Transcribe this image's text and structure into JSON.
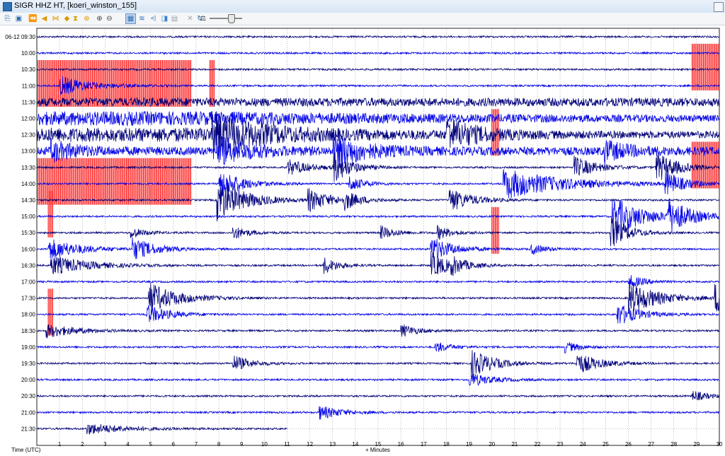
{
  "window": {
    "title": "SIGR HHZ HT, [koeri_winston_155]"
  },
  "toolbar": {
    "tools": [
      {
        "name": "copy-tool",
        "glyph": "⎘",
        "color": "#2a6fb0"
      },
      {
        "name": "export-tool",
        "glyph": "▣",
        "color": "#2a6fb0"
      },
      {
        "name": "jump-back-icon",
        "glyph": "⏪",
        "color": "#d89a00"
      },
      {
        "name": "step-back-icon",
        "glyph": "◀",
        "color": "#d89a00"
      },
      {
        "name": "compress-time-icon",
        "glyph": "⋈",
        "color": "#d89a00"
      },
      {
        "name": "expand-time-icon",
        "glyph": "◆",
        "color": "#d89a00"
      },
      {
        "name": "hourglass-icon",
        "glyph": "⧗",
        "color": "#d89a00"
      },
      {
        "name": "history-icon",
        "glyph": "⊛",
        "color": "#d89a00"
      },
      {
        "name": "zoom-in-icon",
        "glyph": "⊕",
        "color": "#444444"
      },
      {
        "name": "zoom-out-icon",
        "glyph": "⊖",
        "color": "#444444"
      },
      {
        "name": "grid-view-icon",
        "glyph": "▦",
        "color": "#2a6fb0"
      },
      {
        "name": "wave-view-icon",
        "glyph": "≋",
        "color": "#2a6fb0"
      },
      {
        "name": "spectra-icon",
        "glyph": "⩤",
        "color": "#2a6fb0"
      },
      {
        "name": "spectrogram-icon",
        "glyph": "◨",
        "color": "#3a7fd0"
      },
      {
        "name": "clipboard-icon",
        "glyph": "▤",
        "color": "#9aa4ae"
      },
      {
        "name": "close-icon",
        "glyph": "✕",
        "color": "#9aa4ae"
      },
      {
        "name": "scale-icon",
        "glyph": "⚖",
        "color": "#333333"
      },
      {
        "name": "refresh-icon",
        "glyph": "↻",
        "color": "#2a6fb0"
      }
    ]
  },
  "helicorder": {
    "date_prefix": "06-12",
    "row_labels": [
      "06-12 09:30",
      "10:00",
      "10:30",
      "11:00",
      "11:30",
      "12:00",
      "12:30",
      "13:00",
      "13:30",
      "14:00",
      "14:30",
      "15:00",
      "15:30",
      "16:00",
      "16:30",
      "17:00",
      "17:30",
      "18:00",
      "18:30",
      "19:00",
      "19:30",
      "20:00",
      "20:30",
      "21:00",
      "21:30"
    ],
    "x_ticks": [
      "1",
      "2",
      "3",
      "4",
      "5",
      "6",
      "7",
      "8",
      "9",
      "10",
      "11",
      "12",
      "13",
      "14",
      "15",
      "16",
      "17",
      "18",
      "19",
      "20",
      "21",
      "22",
      "23",
      "24",
      "25",
      "26",
      "27",
      "28",
      "29",
      "30"
    ],
    "x_range_minutes": [
      0,
      30
    ],
    "y_axis_label": "Time (UTC)",
    "x_axis_label": "+ Minutes",
    "trace_colors": [
      "#00007a",
      "#0000e8"
    ],
    "clip_color": "#ff0000",
    "grid_color": "#8a8a8a",
    "end_of_data_minute": 11,
    "clip_segments": [
      {
        "row": 3,
        "start_min": 0,
        "end_min": 6.8
      },
      {
        "row": 9,
        "start_min": 0,
        "end_min": 6.8
      },
      {
        "row": 3,
        "start_min": 7.6,
        "end_min": 7.8
      },
      {
        "row": 6,
        "start_min": 20.0,
        "end_min": 20.3
      },
      {
        "row": 12,
        "start_min": 20.0,
        "end_min": 20.3
      },
      {
        "row": 2,
        "start_min": 28.8,
        "end_min": 30
      },
      {
        "row": 8,
        "start_min": 28.8,
        "end_min": 30
      },
      {
        "row": 11,
        "start_min": 0.5,
        "end_min": 0.7
      },
      {
        "row": 17,
        "start_min": 0.5,
        "end_min": 0.7
      }
    ],
    "events": [
      {
        "row": 3,
        "min": 1.0,
        "amp": 14,
        "dur": 2.0
      },
      {
        "row": 6,
        "min": 7.7,
        "amp": 26,
        "dur": 3.0
      },
      {
        "row": 6,
        "min": 18.0,
        "amp": 22,
        "dur": 2.0
      },
      {
        "row": 7,
        "min": 0.6,
        "amp": 14,
        "dur": 1.5
      },
      {
        "row": 7,
        "min": 7.9,
        "amp": 20,
        "dur": 2.0
      },
      {
        "row": 7,
        "min": 13.0,
        "amp": 24,
        "dur": 2.0
      },
      {
        "row": 7,
        "min": 24.9,
        "amp": 14,
        "dur": 1.5
      },
      {
        "row": 8,
        "min": 11.0,
        "amp": 12,
        "dur": 1.5
      },
      {
        "row": 8,
        "min": 13.0,
        "amp": 22,
        "dur": 1.2
      },
      {
        "row": 8,
        "min": 23.6,
        "amp": 16,
        "dur": 1.5
      },
      {
        "row": 8,
        "min": 27.2,
        "amp": 22,
        "dur": 1.5
      },
      {
        "row": 9,
        "min": 8.0,
        "amp": 22,
        "dur": 1.5
      },
      {
        "row": 9,
        "min": 13.7,
        "amp": 12,
        "dur": 1.0
      },
      {
        "row": 9,
        "min": 20.5,
        "amp": 22,
        "dur": 4.0
      },
      {
        "row": 9,
        "min": 27.6,
        "amp": 18,
        "dur": 1.2
      },
      {
        "row": 10,
        "min": 7.9,
        "amp": 30,
        "dur": 2.0
      },
      {
        "row": 10,
        "min": 11.9,
        "amp": 16,
        "dur": 1.5
      },
      {
        "row": 10,
        "min": 13.5,
        "amp": 12,
        "dur": 1.0
      },
      {
        "row": 10,
        "min": 18.1,
        "amp": 18,
        "dur": 1.5
      },
      {
        "row": 11,
        "min": 25.3,
        "amp": 30,
        "dur": 2.0
      },
      {
        "row": 11,
        "min": 27.7,
        "amp": 24,
        "dur": 1.5
      },
      {
        "row": 12,
        "min": 4.1,
        "amp": 8,
        "dur": 1.0
      },
      {
        "row": 12,
        "min": 8.6,
        "amp": 10,
        "dur": 1.0
      },
      {
        "row": 12,
        "min": 15.1,
        "amp": 10,
        "dur": 1.0
      },
      {
        "row": 12,
        "min": 17.6,
        "amp": 10,
        "dur": 1.0
      },
      {
        "row": 12,
        "min": 25.2,
        "amp": 24,
        "dur": 1.2
      },
      {
        "row": 13,
        "min": 0.5,
        "amp": 16,
        "dur": 2.0
      },
      {
        "row": 13,
        "min": 4.2,
        "amp": 16,
        "dur": 1.5
      },
      {
        "row": 13,
        "min": 17.3,
        "amp": 18,
        "dur": 1.5
      },
      {
        "row": 13,
        "min": 21.7,
        "amp": 8,
        "dur": 1.0
      },
      {
        "row": 14,
        "min": 0.6,
        "amp": 14,
        "dur": 2.5
      },
      {
        "row": 14,
        "min": 12.6,
        "amp": 12,
        "dur": 1.0
      },
      {
        "row": 14,
        "min": 17.3,
        "amp": 20,
        "dur": 1.2
      },
      {
        "row": 14,
        "min": 18.2,
        "amp": 10,
        "dur": 1.0
      },
      {
        "row": 15,
        "min": 26.0,
        "amp": 10,
        "dur": 1.0
      },
      {
        "row": 16,
        "min": 4.9,
        "amp": 22,
        "dur": 2.0
      },
      {
        "row": 16,
        "min": 26.0,
        "amp": 24,
        "dur": 2.0
      },
      {
        "row": 16,
        "min": 29.8,
        "amp": 22,
        "dur": 1.0
      },
      {
        "row": 17,
        "min": 4.8,
        "amp": 14,
        "dur": 1.5
      },
      {
        "row": 17,
        "min": 25.5,
        "amp": 16,
        "dur": 1.5
      },
      {
        "row": 18,
        "min": 0.4,
        "amp": 10,
        "dur": 2.0
      },
      {
        "row": 18,
        "min": 16.0,
        "amp": 10,
        "dur": 1.0
      },
      {
        "row": 19,
        "min": 17.5,
        "amp": 8,
        "dur": 1.0
      },
      {
        "row": 19,
        "min": 23.2,
        "amp": 8,
        "dur": 1.0
      },
      {
        "row": 20,
        "min": 8.6,
        "amp": 12,
        "dur": 1.2
      },
      {
        "row": 20,
        "min": 19.1,
        "amp": 20,
        "dur": 1.5
      },
      {
        "row": 20,
        "min": 23.7,
        "amp": 16,
        "dur": 1.5
      },
      {
        "row": 21,
        "min": 19.0,
        "amp": 10,
        "dur": 1.5
      },
      {
        "row": 22,
        "min": 28.8,
        "amp": 8,
        "dur": 1.0
      },
      {
        "row": 23,
        "min": 12.4,
        "amp": 10,
        "dur": 1.5
      },
      {
        "row": 24,
        "min": 2.2,
        "amp": 8,
        "dur": 2.5
      }
    ]
  }
}
